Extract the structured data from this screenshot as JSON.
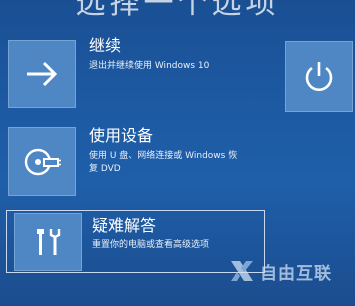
{
  "header": {
    "title_fragment": "选择一个选项"
  },
  "options": [
    {
      "title": "继续",
      "desc": "退出并继续使用 Windows 10",
      "icon": "arrow-right-icon"
    },
    {
      "title": "使用设备",
      "desc_line1": "使用 U 盘、网络连接或 Windows 恢",
      "desc_line2": "复 DVD",
      "icon": "disc-usb-icon"
    },
    {
      "title": "疑难解答",
      "desc": "重置你的电脑或查看高级选项",
      "icon": "tools-icon"
    }
  ],
  "power": {
    "icon": "power-icon"
  },
  "watermark": {
    "text": "自由互联",
    "icon": "x-logo-icon"
  },
  "colors": {
    "background": "#1d5aa3",
    "tile": "#4f86c4",
    "text": "#ffffff"
  }
}
